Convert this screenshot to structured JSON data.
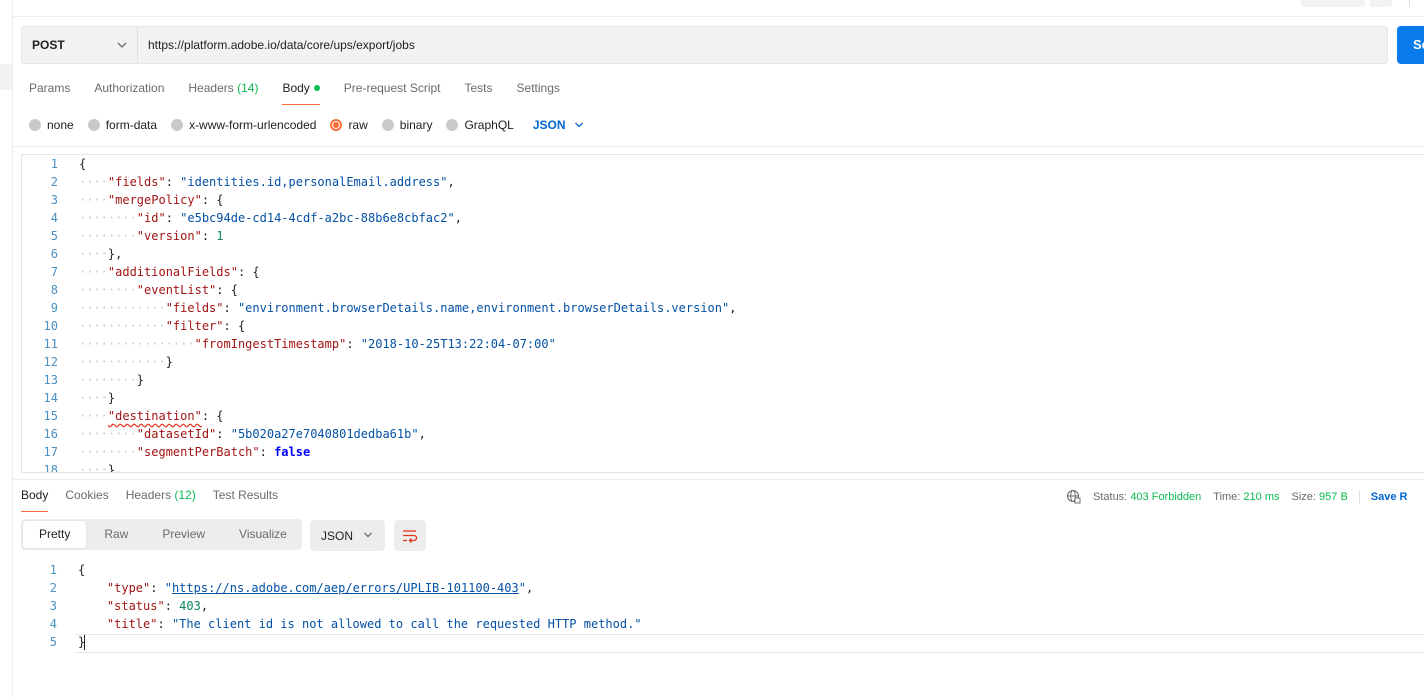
{
  "request": {
    "method": "POST",
    "url": "https://platform.adobe.io/data/core/ups/export/jobs",
    "send_label": "Se"
  },
  "request_tabs": [
    {
      "label": "Params"
    },
    {
      "label": "Authorization"
    },
    {
      "label": "Headers",
      "count": "(14)"
    },
    {
      "label": "Body",
      "active": true,
      "dot": true
    },
    {
      "label": "Pre-request Script"
    },
    {
      "label": "Tests"
    },
    {
      "label": "Settings"
    }
  ],
  "body_types": [
    {
      "label": "none"
    },
    {
      "label": "form-data"
    },
    {
      "label": "x-www-form-urlencoded"
    },
    {
      "label": "raw",
      "selected": true
    },
    {
      "label": "binary"
    },
    {
      "label": "GraphQL"
    }
  ],
  "body_format": "JSON",
  "request_body_lines": [
    "{",
    "    \"fields\": \"identities.id,personalEmail.address\",",
    "    \"mergePolicy\": {",
    "        \"id\": \"e5bc94de-cd14-4cdf-a2bc-88b6e8cbfac2\",",
    "        \"version\": 1",
    "    },",
    "    \"additionalFields\": {",
    "        \"eventList\": {",
    "            \"fields\": \"environment.browserDetails.name,environment.browserDetails.version\",",
    "            \"filter\": {",
    "                \"fromIngestTimestamp\": \"2018-10-25T13:22:04-07:00\"",
    "            }",
    "        }",
    "    }",
    "    \"destination\": {",
    "        \"datasetId\": \"5b020a27e7040801dedba61b\",",
    "        \"segmentPerBatch\": false",
    "    },"
  ],
  "response_tabs": [
    {
      "label": "Body",
      "active": true
    },
    {
      "label": "Cookies"
    },
    {
      "label": "Headers",
      "count": "(12)"
    },
    {
      "label": "Test Results"
    }
  ],
  "response_status": {
    "status_label": "Status:",
    "status_value": "403 Forbidden",
    "time_label": "Time:",
    "time_value": "210 ms",
    "size_label": "Size:",
    "size_value": "957 B",
    "save_label": "Save R"
  },
  "response_views": [
    "Pretty",
    "Raw",
    "Preview",
    "Visualize"
  ],
  "response_format": "JSON",
  "response_body_lines": [
    "{",
    "    \"type\": \"https://ns.adobe.com/aep/errors/UPLIB-101100-403\",",
    "    \"status\": 403,",
    "    \"title\": \"The client id is not allowed to call the requested HTTP method.\"",
    "}"
  ],
  "colors": {
    "accent": "#ff6c37",
    "send": "#097bed",
    "success": "#0cbb52",
    "link": "#0265d2"
  }
}
